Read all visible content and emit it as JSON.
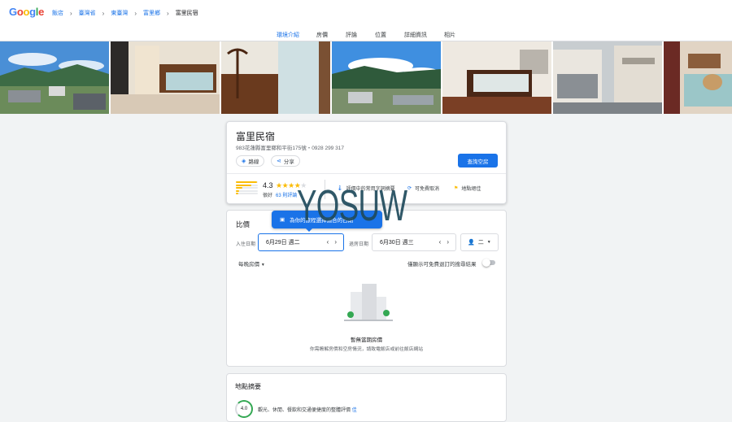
{
  "logo": [
    "G",
    "o",
    "o",
    "g",
    "l",
    "e"
  ],
  "breadcrumb": {
    "items": [
      "飯店",
      "臺灣省",
      "東臺灣",
      "富里鄉"
    ],
    "current": "富里民宿"
  },
  "tabs": [
    "環境介紹",
    "房價",
    "評論",
    "位置",
    "詳細資訊",
    "相片"
  ],
  "active_tab": "環境介紹",
  "hotel": {
    "name": "富里民宿",
    "address": "983花蓮縣富里鄉和平街175號・0928 299 317",
    "route_label": "路線",
    "share_label": "分享",
    "book_label": "查詢空房",
    "score": "4.3",
    "stars_full": 4,
    "rating_word": "很好",
    "reviews": "63 則評論",
    "features": [
      "評價中的常用字詞摘要",
      "可免費取消",
      "地點絕佳"
    ]
  },
  "pricing": {
    "title": "比價",
    "tooltip": "為你的旅程選擇適合的日期",
    "checkin_label": "入住日期",
    "checkin_value": "6月29日 週二",
    "checkout_label": "退房日期",
    "checkout_value": "6月30日 週三",
    "guests": "二",
    "per_night": "每晚房價",
    "free_cancel": "僅顯示可免費退訂的搜尋結果",
    "no_data_title": "暫無當期房價",
    "no_data_sub": "你需瞭解房價和空房情況，請致電飯店或前往飯店網站"
  },
  "location": {
    "title": "地點摘要",
    "score": "4.0",
    "text": "觀光、休閒、餐飲和交通便捷度的整體評價",
    "link": "佳"
  },
  "watermark": "YOSUW",
  "colors": {
    "accent": "#1a73e8",
    "star": "#fbbc05",
    "green": "#34a853"
  }
}
